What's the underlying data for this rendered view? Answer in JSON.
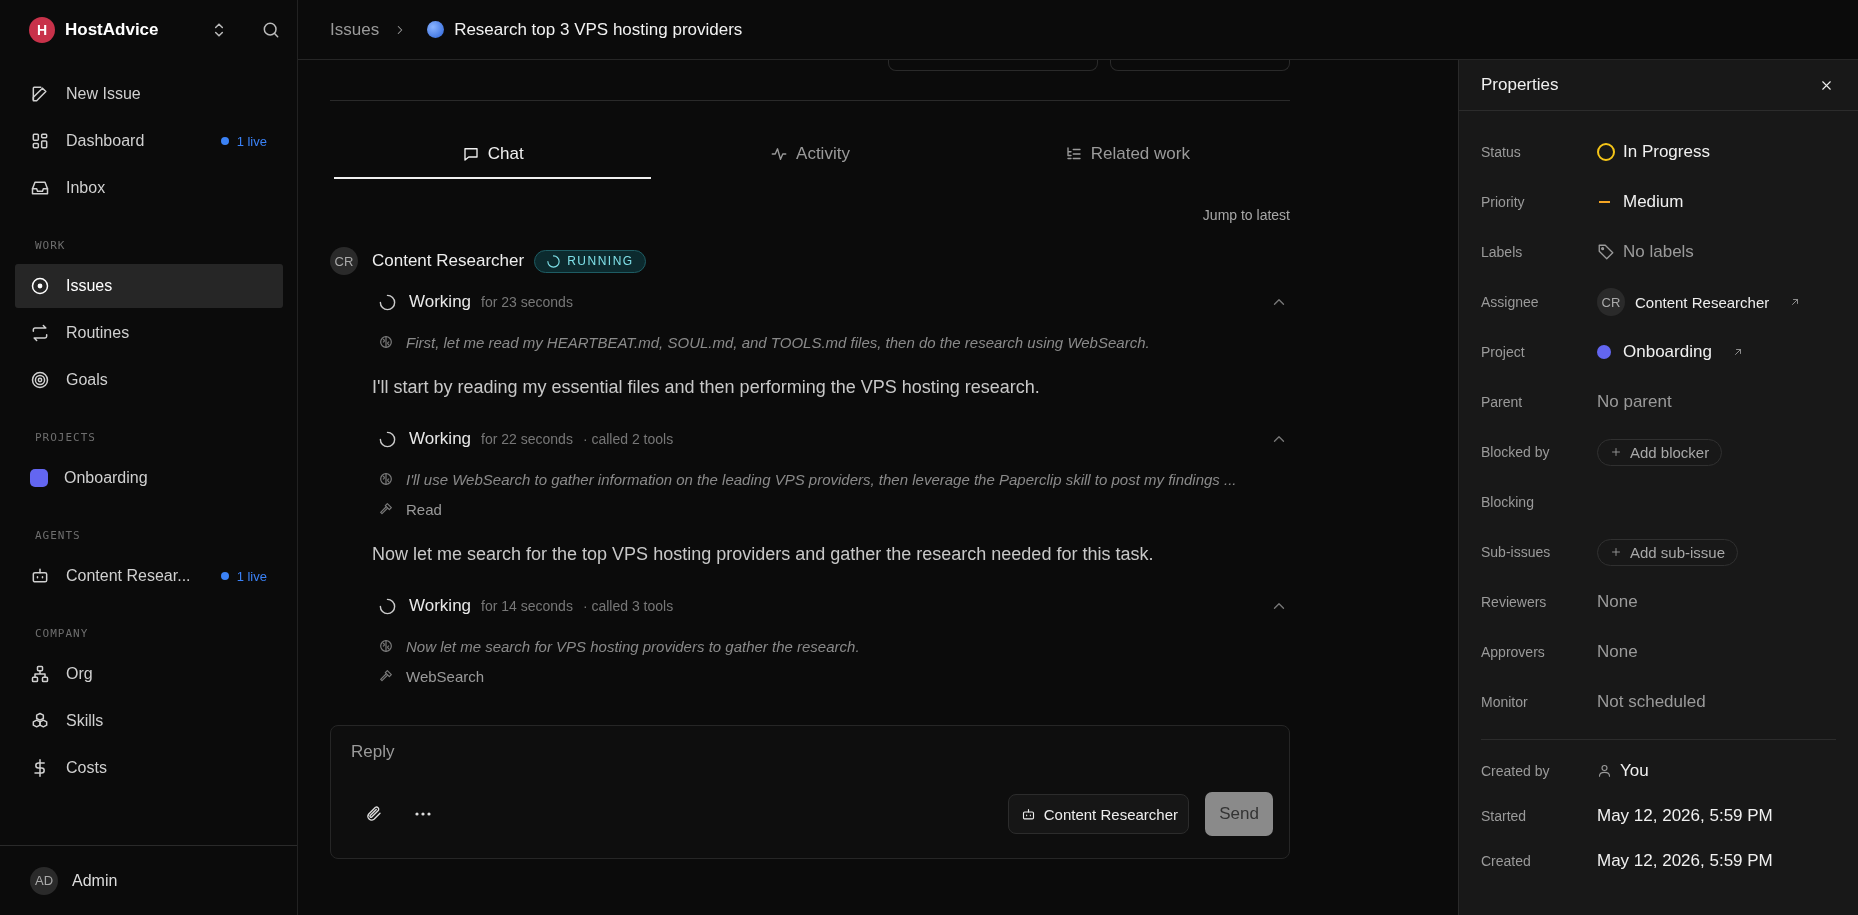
{
  "sidebar": {
    "brand": {
      "initial": "H",
      "name": "HostAdvice"
    },
    "top_items": [
      {
        "label": "New Issue",
        "selected": false
      },
      {
        "label": "Dashboard",
        "badge": "1 live",
        "selected": false
      },
      {
        "label": "Inbox",
        "selected": false
      }
    ],
    "sections": [
      {
        "title": "WORK",
        "items": [
          {
            "label": "Issues",
            "selected": true
          },
          {
            "label": "Routines",
            "selected": false
          },
          {
            "label": "Goals",
            "selected": false
          }
        ]
      },
      {
        "title": "PROJECTS",
        "items": [
          {
            "label": "Onboarding",
            "color": "#6366f1",
            "selected": false
          }
        ]
      },
      {
        "title": "AGENTS",
        "items": [
          {
            "label": "Content Resear...",
            "badge": "1 live",
            "selected": false
          }
        ]
      },
      {
        "title": "COMPANY",
        "items": [
          {
            "label": "Org",
            "selected": false
          },
          {
            "label": "Skills",
            "selected": false
          },
          {
            "label": "Costs",
            "selected": false
          }
        ]
      }
    ],
    "user": {
      "initials": "AD",
      "name": "Admin"
    }
  },
  "breadcrumb": {
    "parent": "Issues",
    "title": "Research top 3 VPS hosting providers"
  },
  "tabs": [
    {
      "label": "Chat",
      "selected": true
    },
    {
      "label": "Activity",
      "selected": false
    },
    {
      "label": "Related work",
      "selected": false
    }
  ],
  "jump_link": "Jump to latest",
  "chat": {
    "author": {
      "initials": "CR",
      "name": "Content Researcher"
    },
    "status": "RUNNING",
    "entries": [
      {
        "kind": "run",
        "label": "Working",
        "duration": "for 23 seconds",
        "expanded": true,
        "thought": "First, let me read my HEARTBEAT.md, SOUL.md, and TOOLS.md files, then do the research using WebSearch."
      },
      {
        "kind": "message",
        "text": "I'll start by reading my essential files and then performing the VPS hosting research."
      },
      {
        "kind": "run",
        "label": "Working",
        "duration": "for 22 seconds",
        "tools": "· called 2 tools",
        "expanded": true,
        "thought": "I'll use WebSearch to gather information on the leading VPS providers, then leverage the Paperclip skill to post my findings ...",
        "tool_call": "Read"
      },
      {
        "kind": "message",
        "text": "Now let me search for the top VPS hosting providers and gather the research needed for this task."
      },
      {
        "kind": "run",
        "label": "Working",
        "duration": "for 14 seconds",
        "tools": "· called 3 tools",
        "expanded": true,
        "thought": "Now let me search for VPS hosting providers to gather the research.",
        "tool_call": "WebSearch"
      }
    ]
  },
  "composer": {
    "placeholder": "Reply",
    "agent": "Content Researcher",
    "send": "Send"
  },
  "properties": {
    "title": "Properties",
    "rows": [
      {
        "label": "Status",
        "kind": "status",
        "value": "In Progress",
        "color": "#f5c518"
      },
      {
        "label": "Priority",
        "kind": "priority",
        "value": "Medium",
        "color": "#f5a524"
      },
      {
        "label": "Labels",
        "kind": "labels",
        "value": "No labels"
      },
      {
        "label": "Assignee",
        "kind": "assignee",
        "initials": "CR",
        "value": "Content Researcher"
      },
      {
        "label": "Project",
        "kind": "project",
        "value": "Onboarding",
        "color": "#6366f1"
      },
      {
        "label": "Parent",
        "kind": "muted",
        "value": "No parent"
      },
      {
        "label": "Blocked by",
        "kind": "add",
        "value": "Add blocker"
      },
      {
        "label": "Blocking",
        "kind": "empty"
      },
      {
        "label": "Sub-issues",
        "kind": "add",
        "value": "Add sub-issue"
      },
      {
        "label": "Reviewers",
        "kind": "muted",
        "value": "None"
      },
      {
        "label": "Approvers",
        "kind": "muted",
        "value": "None"
      },
      {
        "label": "Monitor",
        "kind": "muted",
        "value": "Not scheduled"
      }
    ],
    "meta": [
      {
        "label": "Created by",
        "kind": "user",
        "value": "You"
      },
      {
        "label": "Started",
        "kind": "plain",
        "value": "May 12, 2026, 5:59 PM"
      },
      {
        "label": "Created",
        "kind": "plain",
        "value": "May 12, 2026, 5:59 PM"
      }
    ]
  }
}
